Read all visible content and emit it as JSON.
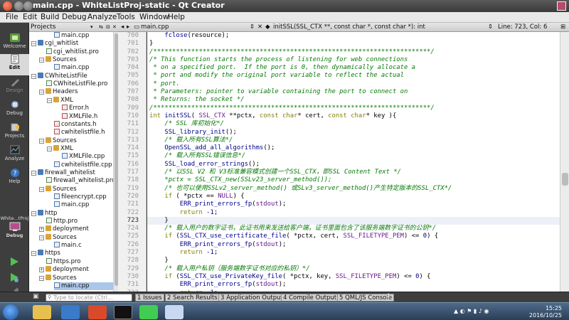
{
  "window": {
    "title": "main.cpp - WhiteListProj-static - Qt Creator"
  },
  "menu": [
    "File",
    "Edit",
    "Build",
    "Debug",
    "Analyze",
    "Tools",
    "Window",
    "Help"
  ],
  "modes": [
    {
      "label": "Welcome",
      "active": false
    },
    {
      "label": "Edit",
      "active": true
    },
    {
      "label": "Design",
      "active": false
    },
    {
      "label": "Debug",
      "active": false
    },
    {
      "label": "Projects",
      "active": false
    },
    {
      "label": "Analyze",
      "active": false
    },
    {
      "label": "Help",
      "active": false
    }
  ],
  "kit": {
    "project": "White...tProj",
    "config": "Debug"
  },
  "projects_panel": {
    "title": "Projects",
    "items": [
      {
        "label": "main.cpp",
        "indent": 3,
        "kind": "cpp"
      },
      {
        "label": "cgi_whitlist",
        "indent": 1,
        "kind": "proj",
        "exp": "−"
      },
      {
        "label": "cgi_whitlist.pro",
        "indent": 2,
        "kind": "pro"
      },
      {
        "label": "Sources",
        "indent": 2,
        "kind": "folder",
        "exp": "−"
      },
      {
        "label": "main.cpp",
        "indent": 3,
        "kind": "cpp"
      },
      {
        "label": "CWhiteListFile",
        "indent": 1,
        "kind": "proj",
        "exp": "−"
      },
      {
        "label": "CWhiteListFile.pro",
        "indent": 2,
        "kind": "pro"
      },
      {
        "label": "Headers",
        "indent": 2,
        "kind": "folder",
        "exp": "−"
      },
      {
        "label": "XML",
        "indent": 3,
        "kind": "folder",
        "exp": "−"
      },
      {
        "label": "Error.h",
        "indent": 4,
        "kind": "h"
      },
      {
        "label": "XMLFile.h",
        "indent": 4,
        "kind": "h"
      },
      {
        "label": "constants.h",
        "indent": 3,
        "kind": "h"
      },
      {
        "label": "cwhitelistfile.h",
        "indent": 3,
        "kind": "h"
      },
      {
        "label": "Sources",
        "indent": 2,
        "kind": "folder",
        "exp": "−"
      },
      {
        "label": "XML",
        "indent": 3,
        "kind": "folder",
        "exp": "−"
      },
      {
        "label": "XMLFile.cpp",
        "indent": 4,
        "kind": "cpp"
      },
      {
        "label": "cwhitelistfile.cpp",
        "indent": 3,
        "kind": "cpp"
      },
      {
        "label": "firewall_whitelist",
        "indent": 1,
        "kind": "proj",
        "exp": "−"
      },
      {
        "label": "firewall_whitelist.pro",
        "indent": 2,
        "kind": "pro"
      },
      {
        "label": "Sources",
        "indent": 2,
        "kind": "folder",
        "exp": "−"
      },
      {
        "label": "fileencrypt.cpp",
        "indent": 3,
        "kind": "cpp"
      },
      {
        "label": "main.cpp",
        "indent": 3,
        "kind": "cpp"
      },
      {
        "label": "http",
        "indent": 1,
        "kind": "proj",
        "exp": "−"
      },
      {
        "label": "http.pro",
        "indent": 2,
        "kind": "pro"
      },
      {
        "label": "deployment",
        "indent": 2,
        "kind": "folder",
        "exp": "+"
      },
      {
        "label": "Sources",
        "indent": 2,
        "kind": "folder",
        "exp": "−"
      },
      {
        "label": "main.c",
        "indent": 3,
        "kind": "cpp"
      },
      {
        "label": "https",
        "indent": 1,
        "kind": "proj",
        "exp": "−"
      },
      {
        "label": "https.pro",
        "indent": 2,
        "kind": "pro"
      },
      {
        "label": "deployment",
        "indent": 2,
        "kind": "folder",
        "exp": "+"
      },
      {
        "label": "Sources",
        "indent": 2,
        "kind": "folder",
        "exp": "−"
      },
      {
        "label": "main.cpp",
        "indent": 3,
        "kind": "cpp",
        "selected": true
      }
    ]
  },
  "editor": {
    "file": "main.cpp",
    "function": "initSSL(SSL_CTX **, const char *, const char *): int",
    "position": "Line: 723, Col: 6",
    "current_line": 723,
    "lines": [
      {
        "n": 700,
        "t": "    fclose(resource);"
      },
      {
        "n": 701,
        "t": "}"
      },
      {
        "n": 702,
        "t": "/*************************************************************************/"
      },
      {
        "n": 703,
        "t": "/* This function starts the process of listening for web connections"
      },
      {
        "n": 704,
        "t": " * on a specified port.  If the port is 0, then dynamically allocate a"
      },
      {
        "n": 705,
        "t": " * port and modify the original port variable to reflect the actual"
      },
      {
        "n": 706,
        "t": " * port."
      },
      {
        "n": 707,
        "t": " * Parameters: pointer to variable containing the port to connect on"
      },
      {
        "n": 708,
        "t": " * Returns: the socket */"
      },
      {
        "n": 709,
        "t": "/*************************************************************************/"
      },
      {
        "n": 710,
        "t": "int initSSL( SSL_CTX **pctx, const char* cert, const char* key ){"
      },
      {
        "n": 711,
        "t": "    /* SSL 库初始化*/"
      },
      {
        "n": 712,
        "t": "    SSL_library_init();"
      },
      {
        "n": 713,
        "t": "    /* 载入所有SSL算法*/"
      },
      {
        "n": 714,
        "t": "    OpenSSL_add_all_algorithms();"
      },
      {
        "n": 715,
        "t": "    /* 载入所有SSL错误信息*/"
      },
      {
        "n": 716,
        "t": "    SSL_load_error_strings();"
      },
      {
        "n": 717,
        "t": "    /* 以SSL V2 和 V3标准兼容模式创建一个SSL_CTX，即SSL Content Text */"
      },
      {
        "n": 718,
        "t": "    *pctx = SSL_CTX_new(SSLv23_server_method());"
      },
      {
        "n": 719,
        "t": "    /* 也可以使用SSLv2_server_method() 或SLv3_server_method()产生特定版本的SSL_CTX*/"
      },
      {
        "n": 720,
        "t": "    if ( *pctx == NULL) {"
      },
      {
        "n": 721,
        "t": "        ERR_print_errors_fp(stdout);"
      },
      {
        "n": 722,
        "t": "        return -1;"
      },
      {
        "n": 723,
        "t": "    }"
      },
      {
        "n": 724,
        "t": "    /* 载入用户的数字证书，此证书用来发送给客户端，证书里面包含了该服务端数字证书的公钥*/"
      },
      {
        "n": 725,
        "t": "    if (SSL_CTX_use_certificate_file( *pctx, cert, SSL_FILETYPE_PEM) <= 0) {"
      },
      {
        "n": 726,
        "t": "        ERR_print_errors_fp(stdout);"
      },
      {
        "n": 727,
        "t": "        return -1;"
      },
      {
        "n": 728,
        "t": "    }"
      },
      {
        "n": 729,
        "t": "    /* 载入用户私钥（服务端数字证书对应的私钥）*/"
      },
      {
        "n": 730,
        "t": "    if (SSL_CTX_use_PrivateKey_file( *pctx, key, SSL_FILETYPE_PEM) <= 0) {"
      },
      {
        "n": 731,
        "t": "        ERR_print_errors_fp(stdout);"
      },
      {
        "n": 732,
        "t": "        return -1;"
      },
      {
        "n": 733,
        "t": "    }"
      }
    ]
  },
  "output_bar": {
    "locate_placeholder": "Type to locate (Ctrl...",
    "tabs": [
      "1 Issues",
      "2 Search Results",
      "3 Application Output",
      "4 Compile Output",
      "5 QML/JS Console"
    ]
  },
  "taskbar": {
    "time": "15:25",
    "date": "2016/10/25"
  }
}
